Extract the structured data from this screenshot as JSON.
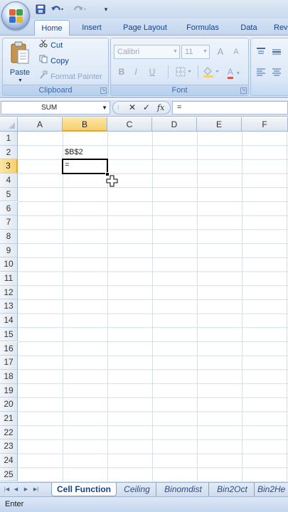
{
  "quick_access": {
    "save_icon": "save-icon",
    "undo_icon": "undo-icon",
    "redo_icon": "redo-icon",
    "customize_label": "▾"
  },
  "tabs": [
    {
      "label": "Home",
      "active": true
    },
    {
      "label": "Insert"
    },
    {
      "label": "Page Layout"
    },
    {
      "label": "Formulas"
    },
    {
      "label": "Data"
    },
    {
      "label": "Rev"
    }
  ],
  "ribbon": {
    "clipboard": {
      "group_label": "Clipboard",
      "paste_label": "Paste",
      "cut_label": "Cut",
      "copy_label": "Copy",
      "format_painter_label": "Format Painter"
    },
    "font": {
      "group_label": "Font",
      "font_name": "Calibri",
      "font_size": "11",
      "grow_label": "A",
      "shrink_label": "A",
      "bold_label": "B",
      "italic_label": "I",
      "underline_label": "U",
      "font_color_label": "A"
    }
  },
  "formula_bar": {
    "name_box": "SUM",
    "cancel_label": "✕",
    "enter_label": "✓",
    "fx_label": "fx",
    "formula": "="
  },
  "columns": [
    "A",
    "B",
    "C",
    "D",
    "E",
    "F"
  ],
  "selected_column": "B",
  "rows": [
    "1",
    "2",
    "3",
    "4",
    "5",
    "6",
    "7",
    "8",
    "9",
    "10",
    "11",
    "12",
    "13",
    "14",
    "15",
    "16",
    "17",
    "18",
    "19",
    "20",
    "21",
    "22",
    "23",
    "24",
    "25"
  ],
  "selected_row": "3",
  "cells": {
    "B2": "$B$2",
    "B3": "="
  },
  "sheet_tabs": [
    {
      "label": "Cell Function",
      "active": true
    },
    {
      "label": "Ceiling"
    },
    {
      "label": "Binomdist"
    },
    {
      "label": "Bin2Oct"
    },
    {
      "label": "Bin2He"
    }
  ],
  "status": {
    "mode": "Enter"
  },
  "colors": {
    "accent": "#15428b",
    "selection_header": "#f8cf6f",
    "ribbon": "#dbe7f6"
  }
}
